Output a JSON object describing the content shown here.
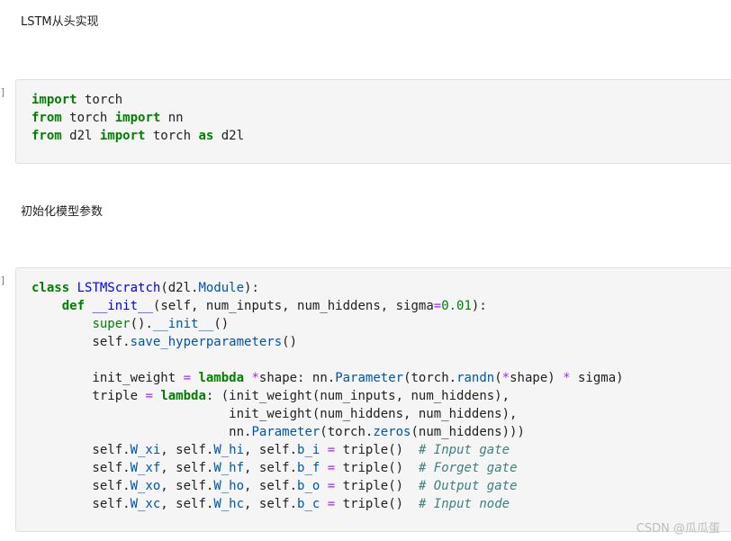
{
  "cells": {
    "md1": {
      "text": "LSTM从头实现"
    },
    "code1": {
      "prompt": "]:",
      "lines": [
        [
          [
            "kw",
            "import"
          ],
          [
            "t",
            " torch"
          ]
        ],
        [
          [
            "kw",
            "from"
          ],
          [
            "t",
            " torch "
          ],
          [
            "kw",
            "import"
          ],
          [
            "t",
            " nn"
          ]
        ],
        [
          [
            "kw",
            "from"
          ],
          [
            "t",
            " d2l "
          ],
          [
            "kw",
            "import"
          ],
          [
            "t",
            " torch "
          ],
          [
            "kw",
            "as"
          ],
          [
            "t",
            " d2l"
          ]
        ]
      ]
    },
    "md2": {
      "text": "初始化模型参数"
    },
    "code2": {
      "prompt": "]:",
      "lines": [
        [
          [
            "kw",
            "class"
          ],
          [
            "t",
            " "
          ],
          [
            "def",
            "LSTMScratch"
          ],
          [
            "t",
            "(d2l."
          ],
          [
            "attr",
            "Module"
          ],
          [
            "t",
            "):"
          ]
        ],
        [
          [
            "t",
            "    "
          ],
          [
            "kw",
            "def"
          ],
          [
            "t",
            " "
          ],
          [
            "mag",
            "__init__"
          ],
          [
            "t",
            "(self, num_inputs, num_hiddens, sigma"
          ],
          [
            "op",
            "="
          ],
          [
            "num",
            "0.01"
          ],
          [
            "t",
            "):"
          ]
        ],
        [
          [
            "t",
            "        "
          ],
          [
            "builtin",
            "super"
          ],
          [
            "t",
            "()."
          ],
          [
            "attr",
            "__init__"
          ],
          [
            "t",
            "()"
          ]
        ],
        [
          [
            "t",
            "        self."
          ],
          [
            "attr",
            "save_hyperparameters"
          ],
          [
            "t",
            "()"
          ]
        ],
        [
          [
            "t",
            ""
          ]
        ],
        [
          [
            "t",
            "        init_weight "
          ],
          [
            "op",
            "="
          ],
          [
            "t",
            " "
          ],
          [
            "kw",
            "lambda"
          ],
          [
            "t",
            " "
          ],
          [
            "op",
            "*"
          ],
          [
            "t",
            "shape: nn."
          ],
          [
            "attr",
            "Parameter"
          ],
          [
            "t",
            "(torch."
          ],
          [
            "attr",
            "randn"
          ],
          [
            "t",
            "("
          ],
          [
            "op",
            "*"
          ],
          [
            "t",
            "shape) "
          ],
          [
            "op",
            "*"
          ],
          [
            "t",
            " sigma)"
          ]
        ],
        [
          [
            "t",
            "        triple "
          ],
          [
            "op",
            "="
          ],
          [
            "t",
            " "
          ],
          [
            "kw",
            "lambda"
          ],
          [
            "t",
            ": (init_weight(num_inputs, num_hiddens),"
          ]
        ],
        [
          [
            "t",
            "                          init_weight(num_hiddens, num_hiddens),"
          ]
        ],
        [
          [
            "t",
            "                          nn."
          ],
          [
            "attr",
            "Parameter"
          ],
          [
            "t",
            "(torch."
          ],
          [
            "attr",
            "zeros"
          ],
          [
            "t",
            "(num_hiddens)))"
          ]
        ],
        [
          [
            "t",
            "        self."
          ],
          [
            "attr",
            "W_xi"
          ],
          [
            "t",
            ", self."
          ],
          [
            "attr",
            "W_hi"
          ],
          [
            "t",
            ", self."
          ],
          [
            "attr",
            "b_i"
          ],
          [
            "t",
            " "
          ],
          [
            "op",
            "="
          ],
          [
            "t",
            " triple()  "
          ],
          [
            "cm",
            "# Input gate"
          ]
        ],
        [
          [
            "t",
            "        self."
          ],
          [
            "attr",
            "W_xf"
          ],
          [
            "t",
            ", self."
          ],
          [
            "attr",
            "W_hf"
          ],
          [
            "t",
            ", self."
          ],
          [
            "attr",
            "b_f"
          ],
          [
            "t",
            " "
          ],
          [
            "op",
            "="
          ],
          [
            "t",
            " triple()  "
          ],
          [
            "cm",
            "# Forget gate"
          ]
        ],
        [
          [
            "t",
            "        self."
          ],
          [
            "attr",
            "W_xo"
          ],
          [
            "t",
            ", self."
          ],
          [
            "attr",
            "W_ho"
          ],
          [
            "t",
            ", self."
          ],
          [
            "attr",
            "b_o"
          ],
          [
            "t",
            " "
          ],
          [
            "op",
            "="
          ],
          [
            "t",
            " triple()  "
          ],
          [
            "cm",
            "# Output gate"
          ]
        ],
        [
          [
            "t",
            "        self."
          ],
          [
            "attr",
            "W_xc"
          ],
          [
            "t",
            ", self."
          ],
          [
            "attr",
            "W_hc"
          ],
          [
            "t",
            ", self."
          ],
          [
            "attr",
            "b_c"
          ],
          [
            "t",
            " "
          ],
          [
            "op",
            "="
          ],
          [
            "t",
            " triple()  "
          ],
          [
            "cm",
            "# Input node"
          ]
        ]
      ]
    }
  },
  "watermark": "CSDN @瓜瓜蛋"
}
